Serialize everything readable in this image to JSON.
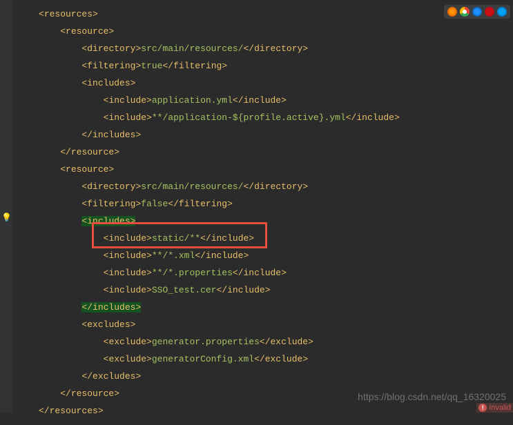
{
  "code": {
    "resources_open": "resources",
    "resource_open": "resource",
    "directory_tag": "directory",
    "directory_val": "src/main/resources/",
    "filtering_tag": "filtering",
    "filtering_true": "true",
    "filtering_false": "false",
    "includes_tag": "includes",
    "include_tag": "include",
    "include_app_yml": "application.yml",
    "include_profile_yml_prefix": "**/application-",
    "include_profile_var": "${profile.active}",
    "include_profile_yml_suffix": ".yml",
    "include_static": "static/**",
    "include_xml": "**/*.xml",
    "include_props": "**/*.properties",
    "include_cer": "SSO_test.cer",
    "excludes_tag": "excludes",
    "exclude_tag": "exclude",
    "exclude_gen_props": "generator.properties",
    "exclude_gen_cfg": "generatorConfig.xml"
  },
  "watermark": "https://blog.csdn.net/qq_16320025",
  "status": "Invalid",
  "icons": [
    "firefox",
    "chrome",
    "safari",
    "opera",
    "ie"
  ]
}
